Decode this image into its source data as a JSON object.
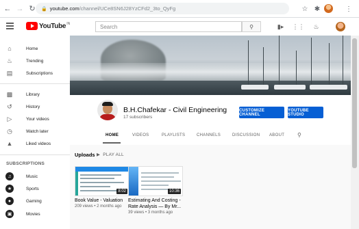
{
  "browser": {
    "url_host": "youtube.com",
    "url_path": "/channel/UCe8SN6J28YzCFd2_3to_QyFg"
  },
  "header": {
    "logo_text": "YouTube",
    "country": "IN",
    "search_placeholder": "Search"
  },
  "sidebar": {
    "items": [
      {
        "label": "Home",
        "icon": "home-icon"
      },
      {
        "label": "Trending",
        "icon": "fire-icon"
      },
      {
        "label": "Subscriptions",
        "icon": "subscriptions-icon"
      },
      {
        "label": "Library",
        "icon": "library-icon"
      },
      {
        "label": "History",
        "icon": "history-icon"
      },
      {
        "label": "Your videos",
        "icon": "your-videos-icon"
      },
      {
        "label": "Watch later",
        "icon": "clock-icon"
      },
      {
        "label": "Liked videos",
        "icon": "thumb-up-icon"
      }
    ],
    "subscriptions_title": "SUBSCRIPTIONS",
    "subscriptions": [
      {
        "label": "Music",
        "icon": "music-icon"
      },
      {
        "label": "Sports",
        "icon": "trophy-icon"
      },
      {
        "label": "Gaming",
        "icon": "gamepad-icon"
      },
      {
        "label": "Movies",
        "icon": "film-icon"
      }
    ]
  },
  "channel": {
    "name": "B.H.Chafekar - Civil Engineering",
    "subscribers": "17 subscribers",
    "customize_label": "CUSTOMIZE CHANNEL",
    "studio_label": "YOUTUBE STUDIO",
    "accent": "#065fd4",
    "tabs": [
      "HOME",
      "VIDEOS",
      "PLAYLISTS",
      "CHANNELS",
      "DISCUSSION",
      "ABOUT"
    ]
  },
  "uploads": {
    "title": "Uploads",
    "play_all": "PLAY ALL",
    "videos": [
      {
        "title": "Book Value - Valuation",
        "meta": "209 views • 2 months ago",
        "duration": "8:02"
      },
      {
        "title_line1": "Estimating And Costing -",
        "title_line2": "Rate Analysis — By Mr...",
        "meta": "39 views • 3 months ago",
        "duration": "10:36"
      }
    ]
  }
}
